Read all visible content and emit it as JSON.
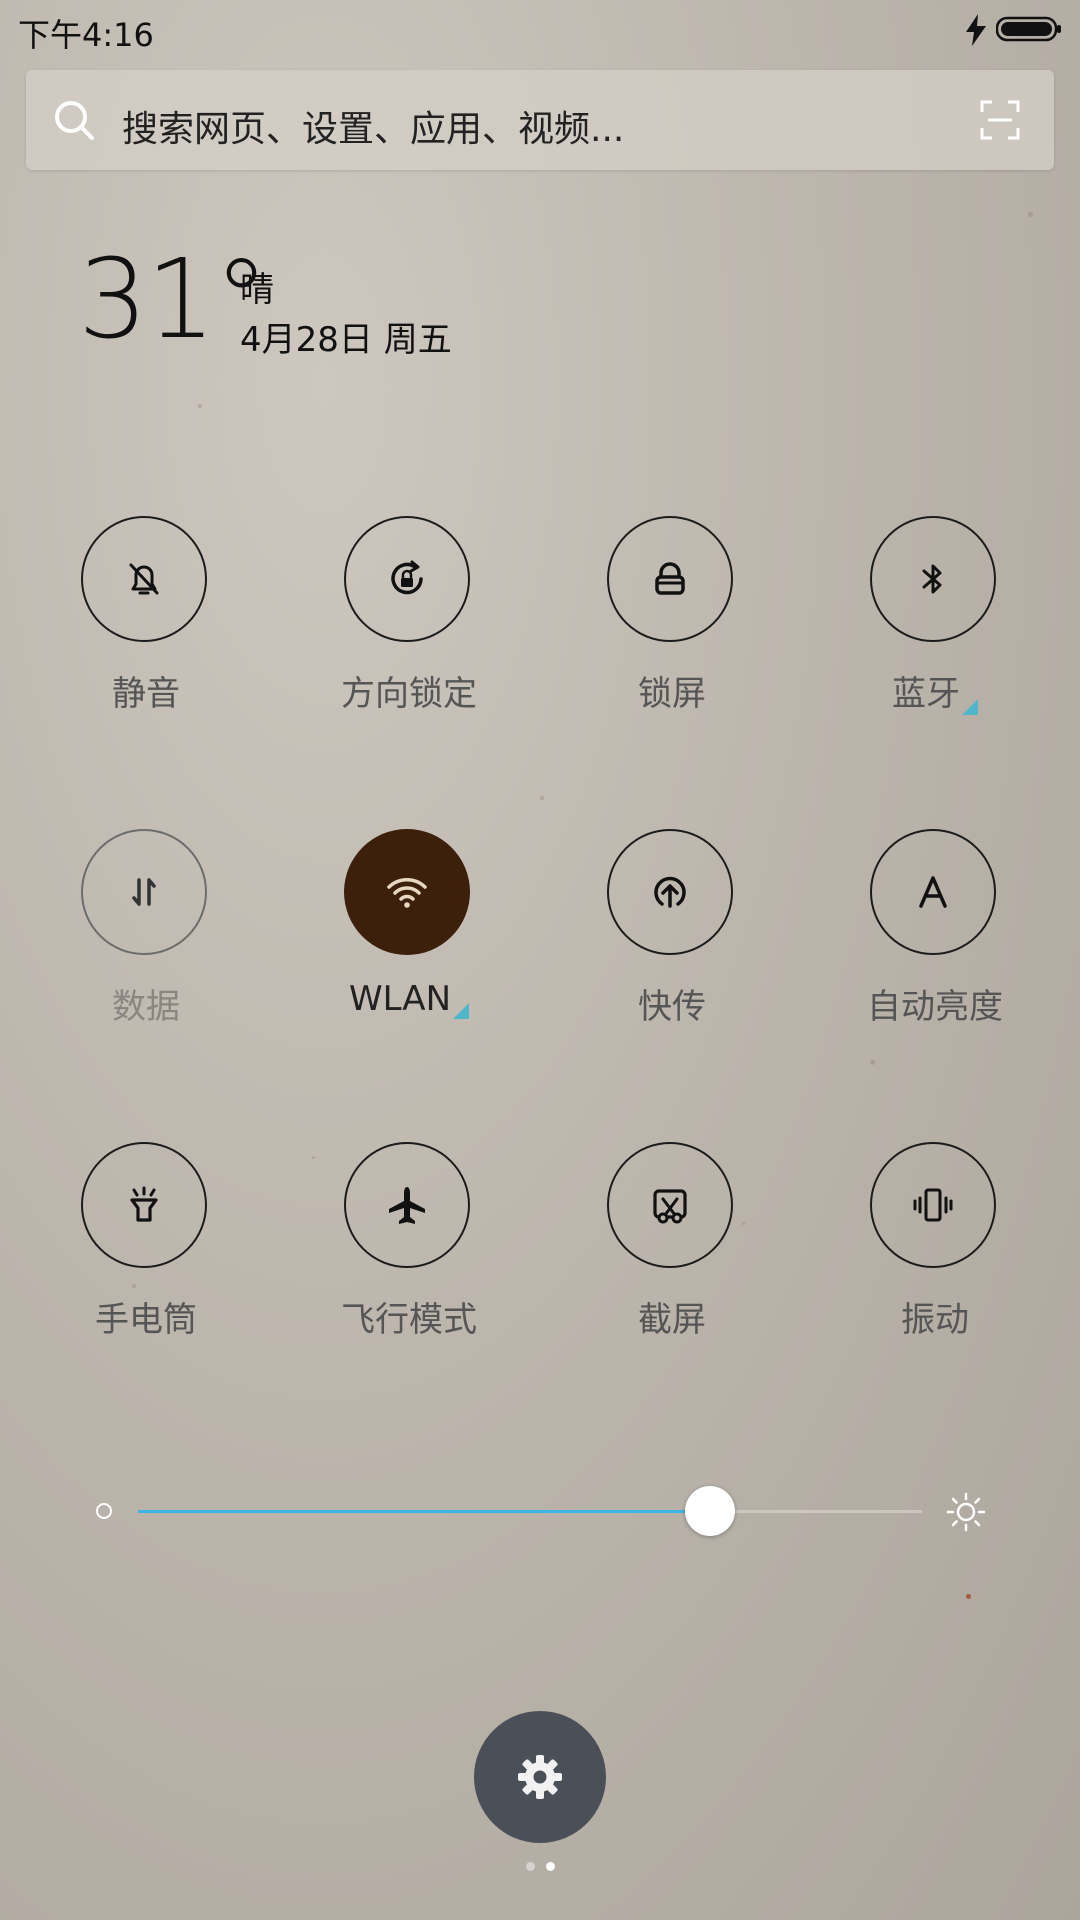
{
  "status_bar": {
    "time": "下午4:16",
    "charging_icon": "bolt-icon",
    "battery_icon": "battery-icon"
  },
  "search": {
    "placeholder": "搜索网页、设置、应用、视频...",
    "search_icon": "search-icon",
    "scan_icon": "scan-icon"
  },
  "weather": {
    "temperature": "31°",
    "condition": "晴",
    "date": "4月28日 周五"
  },
  "toggles": [
    {
      "label": "静音",
      "icon": "bell-off-icon",
      "state": "off"
    },
    {
      "label": "方向锁定",
      "icon": "rotation-lock-icon",
      "state": "off"
    },
    {
      "label": "锁屏",
      "icon": "lock-icon",
      "state": "off"
    },
    {
      "label": "蓝牙",
      "icon": "bluetooth-icon",
      "state": "off",
      "has_more": true
    },
    {
      "label": "数据",
      "icon": "data-arrows-icon",
      "state": "disabled"
    },
    {
      "label": "WLAN",
      "icon": "wifi-icon",
      "state": "on",
      "has_more": true
    },
    {
      "label": "快传",
      "icon": "share-upload-icon",
      "state": "off"
    },
    {
      "label": "自动亮度",
      "icon": "auto-brightness-icon",
      "state": "off"
    },
    {
      "label": "手电筒",
      "icon": "flashlight-icon",
      "state": "off"
    },
    {
      "label": "飞行模式",
      "icon": "airplane-icon",
      "state": "off"
    },
    {
      "label": "截屏",
      "icon": "screenshot-icon",
      "state": "off"
    },
    {
      "label": "振动",
      "icon": "vibrate-icon",
      "state": "off"
    }
  ],
  "brightness": {
    "level": 0.73,
    "low_icon": "brightness-low-icon",
    "high_icon": "brightness-high-icon"
  },
  "settings_button": {
    "icon": "gear-icon"
  },
  "pager": {
    "count": 2,
    "active_index": 1
  },
  "colors": {
    "active_toggle": "#3d200b",
    "accent": "#3fb3e2",
    "corner_marker": "#4fb7c9",
    "fab": "#4a4f58"
  }
}
